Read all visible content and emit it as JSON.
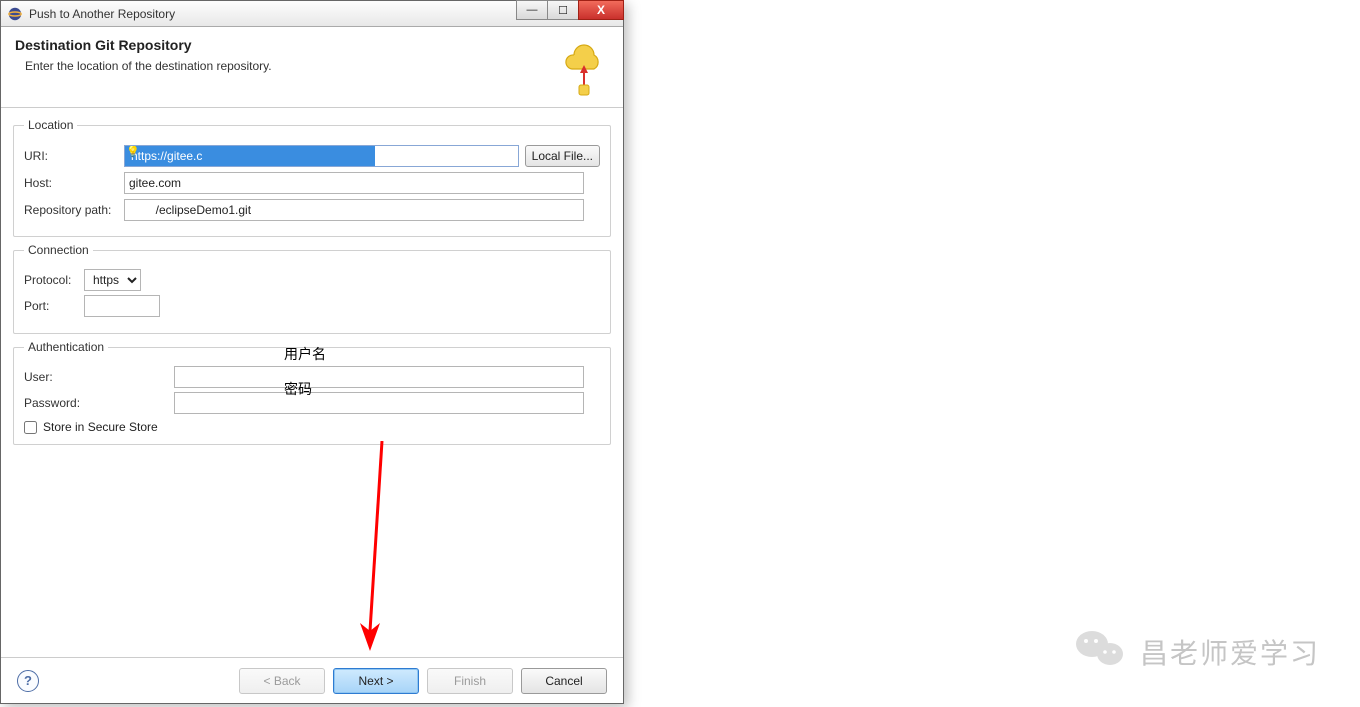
{
  "window": {
    "title": "Push to Another Repository"
  },
  "banner": {
    "title": "Destination Git Repository",
    "subtitle": "Enter the location of the destination repository."
  },
  "groups": {
    "location": {
      "legend": "Location",
      "uri_label": "URI:",
      "uri_value": "https://gitee.c",
      "local_file_btn": "Local File...",
      "host_label": "Host:",
      "host_value": "gitee.com",
      "repo_label": "Repository path:",
      "repo_value": "        /eclipseDemo1.git"
    },
    "connection": {
      "legend": "Connection",
      "protocol_label": "Protocol:",
      "protocol_value": "https",
      "port_label": "Port:",
      "port_value": ""
    },
    "auth": {
      "legend": "Authentication",
      "user_label": "User:",
      "user_value": "",
      "pass_label": "Password:",
      "pass_value": "",
      "store_label": "Store in Secure Store",
      "store_checked": false
    }
  },
  "annotations": {
    "user_hint": "用户名",
    "pass_hint": "密码"
  },
  "footer": {
    "back": "< Back",
    "next": "Next >",
    "finish": "Finish",
    "cancel": "Cancel"
  },
  "watermark": {
    "text": "昌老师爱学习"
  }
}
